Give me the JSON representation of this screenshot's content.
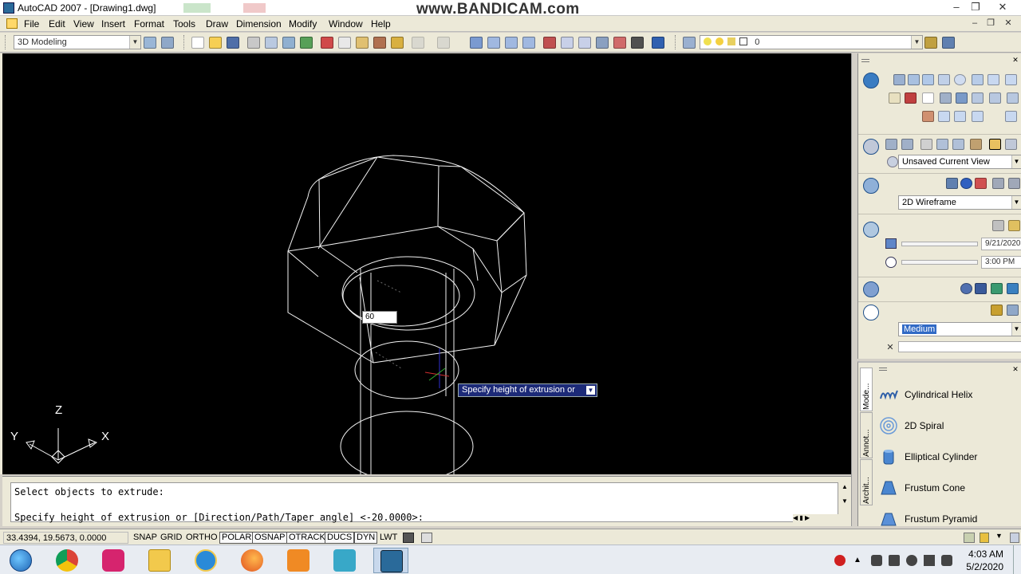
{
  "window": {
    "title": "AutoCAD 2007 - [Drawing1.dwg]",
    "watermark": "www.BANDICAM.com"
  },
  "menu": [
    "File",
    "Edit",
    "View",
    "Insert",
    "Format",
    "Tools",
    "Draw",
    "Dimension",
    "Modify",
    "Window",
    "Help"
  ],
  "toolbar": {
    "workspace": "3D Modeling",
    "layer_value": "0"
  },
  "viewport": {
    "dynamic_input_value": "60",
    "tooltip": "Specify height of extrusion or",
    "ucs": {
      "z": "Z",
      "y": "Y",
      "x": "X"
    }
  },
  "dashboard": {
    "view_combo": "Unsaved Current View",
    "visual_style": "2D Wireframe",
    "sun_date": "9/21/2020",
    "sun_time": "3:00 PM",
    "render_preset": "Medium"
  },
  "tool_palette": {
    "tabs": [
      "Mode...",
      "Annot...",
      "Archit..."
    ],
    "items": [
      {
        "label": "Cylindrical Helix",
        "icon": "helix-icon"
      },
      {
        "label": "2D Spiral",
        "icon": "spiral-icon"
      },
      {
        "label": "Elliptical Cylinder",
        "icon": "elliptical-cylinder-icon"
      },
      {
        "label": "Frustum Cone",
        "icon": "frustum-cone-icon"
      },
      {
        "label": "Frustum Pyramid",
        "icon": "frustum-pyramid-icon"
      }
    ]
  },
  "command_line": {
    "line1": "Select objects to extrude:",
    "line2": "Specify height of extrusion or [Direction/Path/Taper angle] <-20.0000>:"
  },
  "status_bar": {
    "coords": "33.4394, 19.5673, 0.0000",
    "toggles": [
      {
        "label": "SNAP",
        "on": false
      },
      {
        "label": "GRID",
        "on": false
      },
      {
        "label": "ORTHO",
        "on": false
      },
      {
        "label": "POLAR",
        "on": true
      },
      {
        "label": "OSNAP",
        "on": true
      },
      {
        "label": "OTRACK",
        "on": true
      },
      {
        "label": "DUCS",
        "on": true
      },
      {
        "label": "DYN",
        "on": true
      },
      {
        "label": "LWT",
        "on": false
      }
    ]
  },
  "taskbar": {
    "time": "4:03 AM",
    "date": "5/2/2020"
  }
}
